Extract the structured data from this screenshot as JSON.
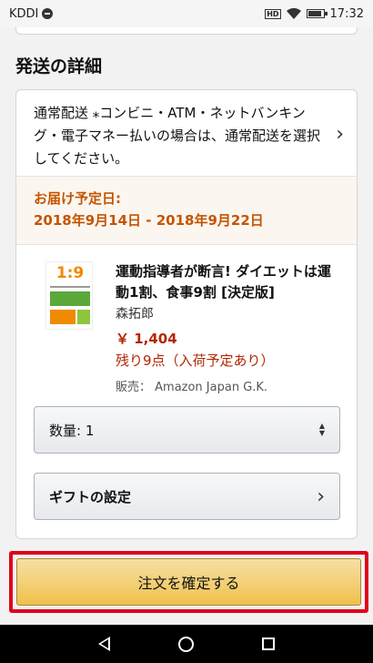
{
  "statusbar": {
    "carrier": "KDDI",
    "time": "17:32",
    "hd": "HD"
  },
  "section": {
    "title": "発送の詳細"
  },
  "shipping": {
    "text": "通常配送 ⁎コンビニ・ATM・ネットバンキング・電子マネー払いの場合は、通常配送を選択してください。"
  },
  "delivery": {
    "label": "お届け予定日:",
    "range": "2018年9月14日 - 2018年9月22日"
  },
  "item": {
    "cover_text": "1:9",
    "title": "運動指導者が断言! ダイエットは運動1割、食事9割 [決定版]",
    "author": "森拓郎",
    "price": "￥ 1,404",
    "stock": "残り9点（入荷予定あり）",
    "seller": "販売： Amazon Japan G.K."
  },
  "quantity": {
    "label": "数量: 1"
  },
  "gift": {
    "label": "ギフトの設定"
  },
  "confirm": {
    "label": "注文を確定する"
  },
  "colors": {
    "accent_orange": "#c45500",
    "price_red": "#b12704",
    "highlight_red": "#e0001b",
    "button_yellow": "#f0c14b"
  }
}
